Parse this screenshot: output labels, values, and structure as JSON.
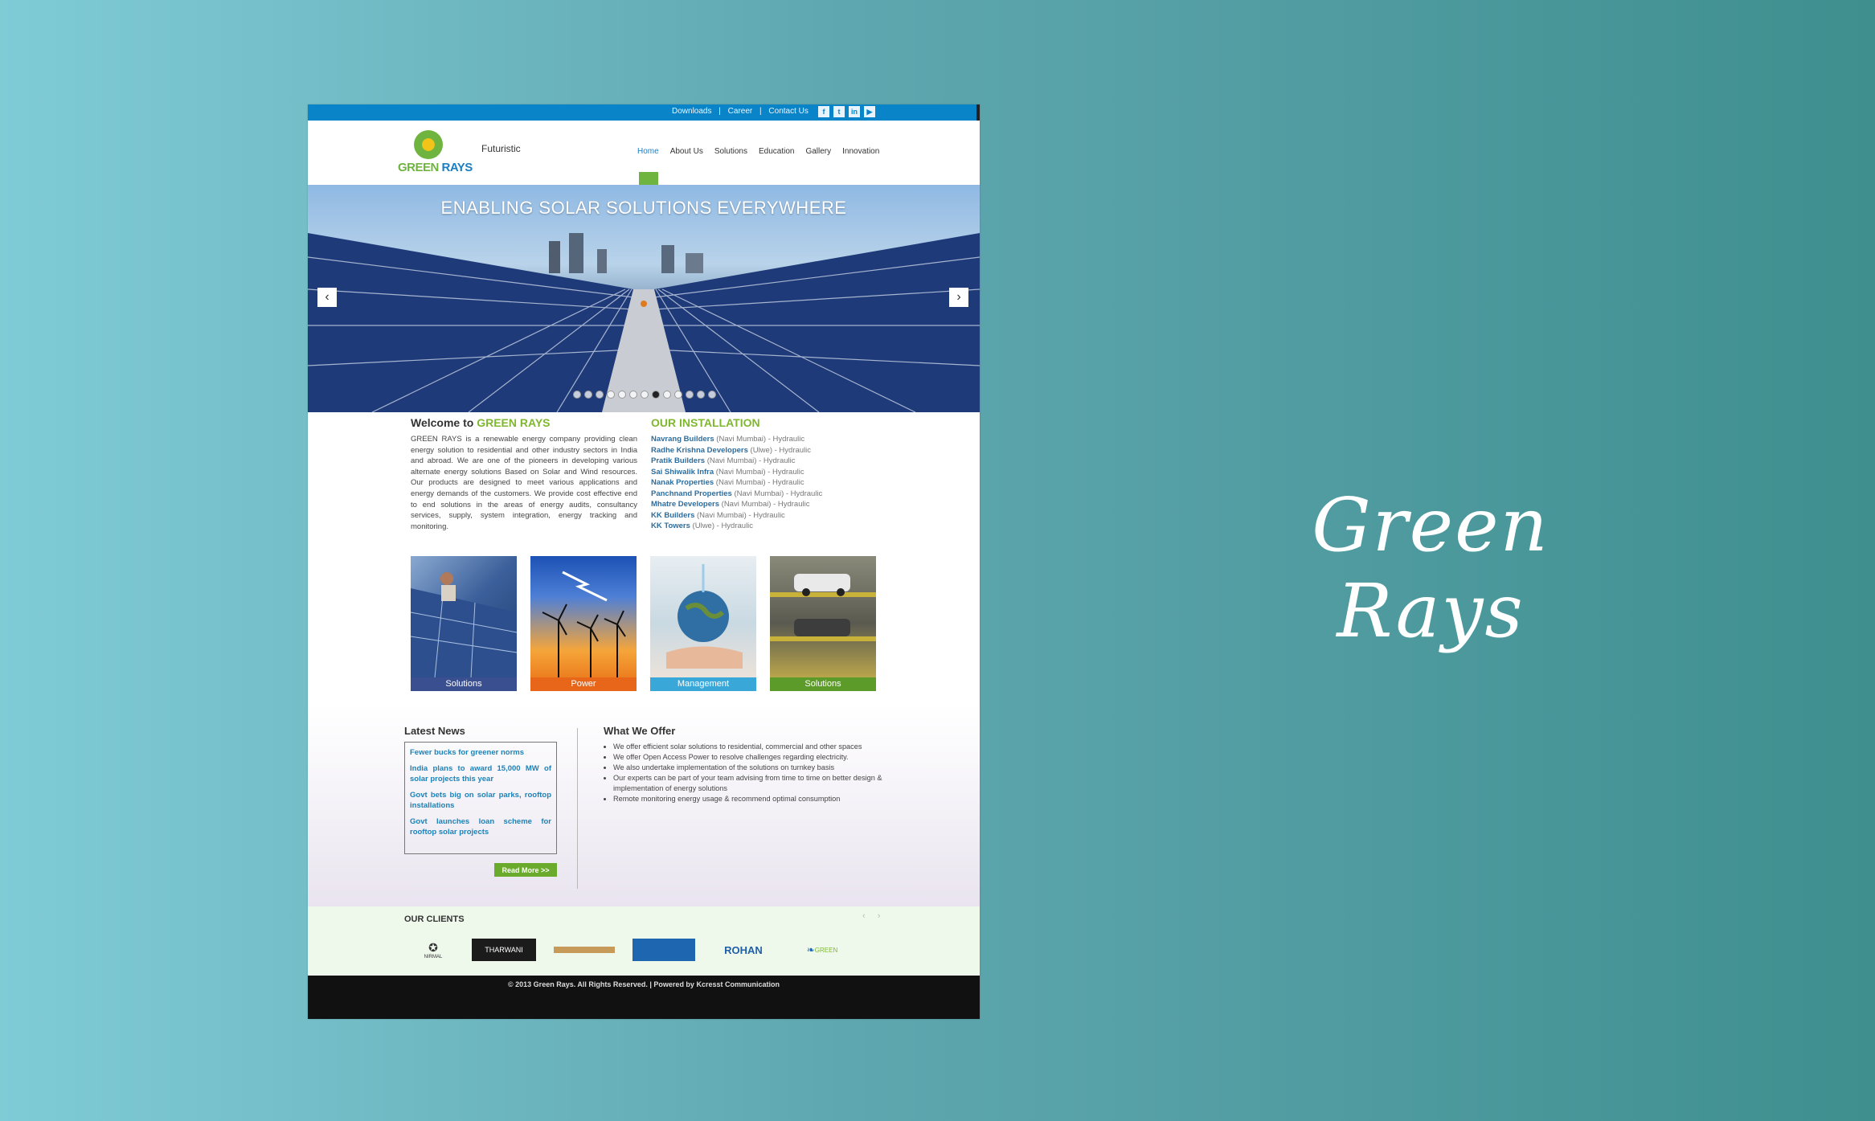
{
  "showcase": {
    "title": "Green Rays"
  },
  "topbar": {
    "links": [
      "Downloads",
      "|",
      "Career",
      "|",
      "Contact Us"
    ],
    "socials": [
      "f",
      "t",
      "in",
      "yt"
    ]
  },
  "header": {
    "logo_word_1": "GREEN",
    "logo_word_2": "RAYS",
    "tagline": "Futuristic",
    "nav": [
      "Home",
      "About Us",
      "Solutions",
      "Education",
      "Gallery",
      "Innovation"
    ],
    "active_nav": "Home"
  },
  "slider": {
    "heading": "ENABLING SOLAR SOLUTIONS EVERYWHERE",
    "prev": "‹",
    "next": "›",
    "slide_count": 13,
    "active_slide": 8
  },
  "welcome": {
    "heading_prefix": "Welcome to",
    "heading_brand": "GREEN RAYS",
    "text": "GREEN RAYS is a renewable energy company providing clean energy solution to residential and other industry sectors in India and abroad. We are one of the pioneers in developing various alternate energy solutions Based on Solar and Wind resources. Our products are designed to meet various applications and energy demands of the customers. We provide cost effective end to end solutions in the areas of energy audits, consultancy services, supply, system integration, energy tracking and monitoring."
  },
  "installations": {
    "title": "OUR INSTALLATION",
    "rows": [
      {
        "name": "Navrang Builders",
        "detail": "(Navi Mumbai) - Hydraulic"
      },
      {
        "name": "Radhe Krishna Developers",
        "detail": "(Ulwe) - Hydraulic"
      },
      {
        "name": "Pratik Builders",
        "detail": "(Navi Mumbai) - Hydraulic"
      },
      {
        "name": "Sai Shiwalik Infra",
        "detail": "(Navi Mumbai) - Hydraulic"
      },
      {
        "name": "Nanak Properties",
        "detail": "(Navi Mumbai) - Hydraulic"
      },
      {
        "name": "Panchnand Properties",
        "detail": "(Navi Mumbai) - Hydraulic"
      },
      {
        "name": "Mhatre Developers",
        "detail": "(Navi Mumbai) - Hydraulic"
      },
      {
        "name": "KK Builders",
        "detail": "(Navi Mumbai) - Hydraulic"
      },
      {
        "name": "KK Towers",
        "detail": "(Ulwe) - Hydraulic"
      }
    ]
  },
  "tiles": [
    {
      "label": "Solutions",
      "color": "#3a4f8f"
    },
    {
      "label": "Power",
      "color": "#e8661a"
    },
    {
      "label": "Management",
      "color": "#3aa7d9"
    },
    {
      "label": "Solutions",
      "color": "#5c9a2a"
    }
  ],
  "news": {
    "title": "Latest News",
    "items": [
      "Fewer bucks for greener norms",
      "India plans to award 15,000 MW of solar projects this year",
      "Govt bets big on solar parks, rooftop installations",
      "Govt launches loan scheme for rooftop solar projects"
    ],
    "read_more": "Read More >>"
  },
  "offer": {
    "title": "What We Offer",
    "items": [
      "We offer efficient solar solutions to residential, commercial and other spaces",
      "We offer Open Access Power to resolve challenges regarding electricity.",
      "We also undertake implementation of the solutions on turnkey basis",
      "Our experts can be part of your team advising from time to time on better design & implementation of energy solutions",
      "Remote monitoring energy usage & recommend optimal consumption"
    ]
  },
  "clients": {
    "title": "OUR CLIENTS",
    "arrows": "‹ ›",
    "logos": [
      "NIRMAL",
      "THARWANI",
      "",
      "",
      "ROHAN",
      "GREEN"
    ]
  },
  "footer": {
    "text": "© 2013 Green Rays. All Rights Reserved. | Powered by Kcresst Communication"
  }
}
